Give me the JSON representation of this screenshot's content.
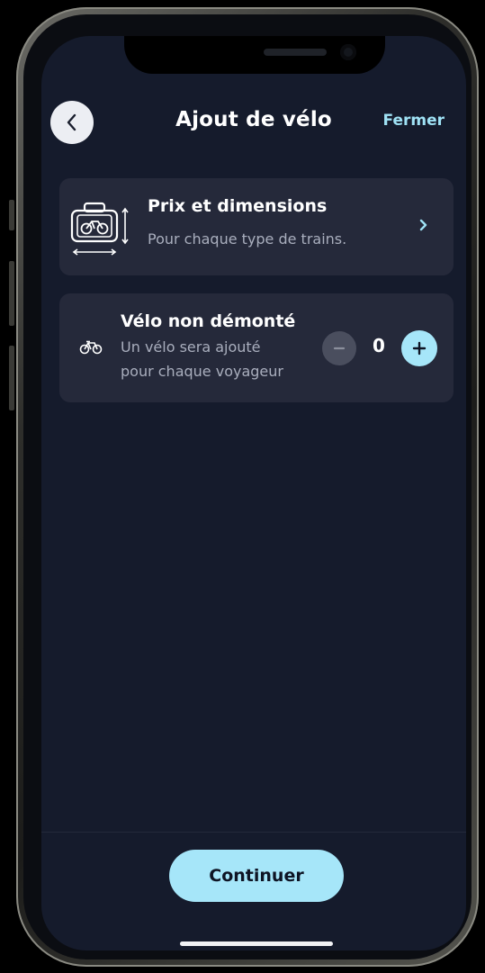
{
  "header": {
    "title": "Ajout de vélo",
    "close_label": "Fermer",
    "back_icon": "chevron-left-icon"
  },
  "info_card": {
    "title": "Prix et dimensions",
    "subtitle": "Pour chaque type de trains.",
    "icon": "bike-dimensions-icon",
    "chevron_icon": "chevron-right-icon"
  },
  "bike_card": {
    "title": "Vélo non démonté",
    "subtitle_line1": "Un vélo sera ajouté",
    "subtitle_line2": "pour chaque voyageur",
    "icon": "bike-icon",
    "quantity": "0"
  },
  "footer": {
    "continue_label": "Continuer"
  },
  "colors": {
    "background": "#151b2c",
    "card": "#25293a",
    "accent": "#a6e6f9",
    "link": "#9fe2f5"
  }
}
